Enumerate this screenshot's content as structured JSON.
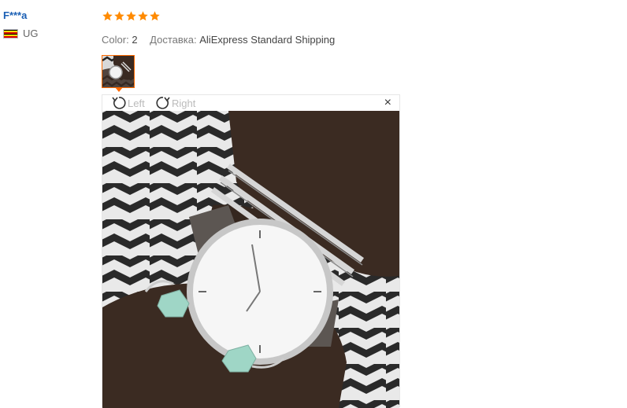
{
  "reviewer": {
    "name": "F***a",
    "country_code": "UG",
    "flag_colors": [
      "#000000",
      "#fcdc04",
      "#d90000",
      "#000000",
      "#fcdc04",
      "#d90000"
    ]
  },
  "feedback": {
    "rating_stars": 5,
    "star_color": "#ff8a00",
    "color_label": "Color:",
    "color_value": "2",
    "delivery_label": "Доставка:",
    "delivery_value": "AliExpress Standard Shipping"
  },
  "viewer": {
    "rotate_left_label": "Left",
    "rotate_right_label": "Right",
    "close_glyph": "×",
    "photo_description_icon": "watch-photo"
  },
  "colors": {
    "accent": "#ff6a00",
    "link": "#1a5fb4"
  }
}
